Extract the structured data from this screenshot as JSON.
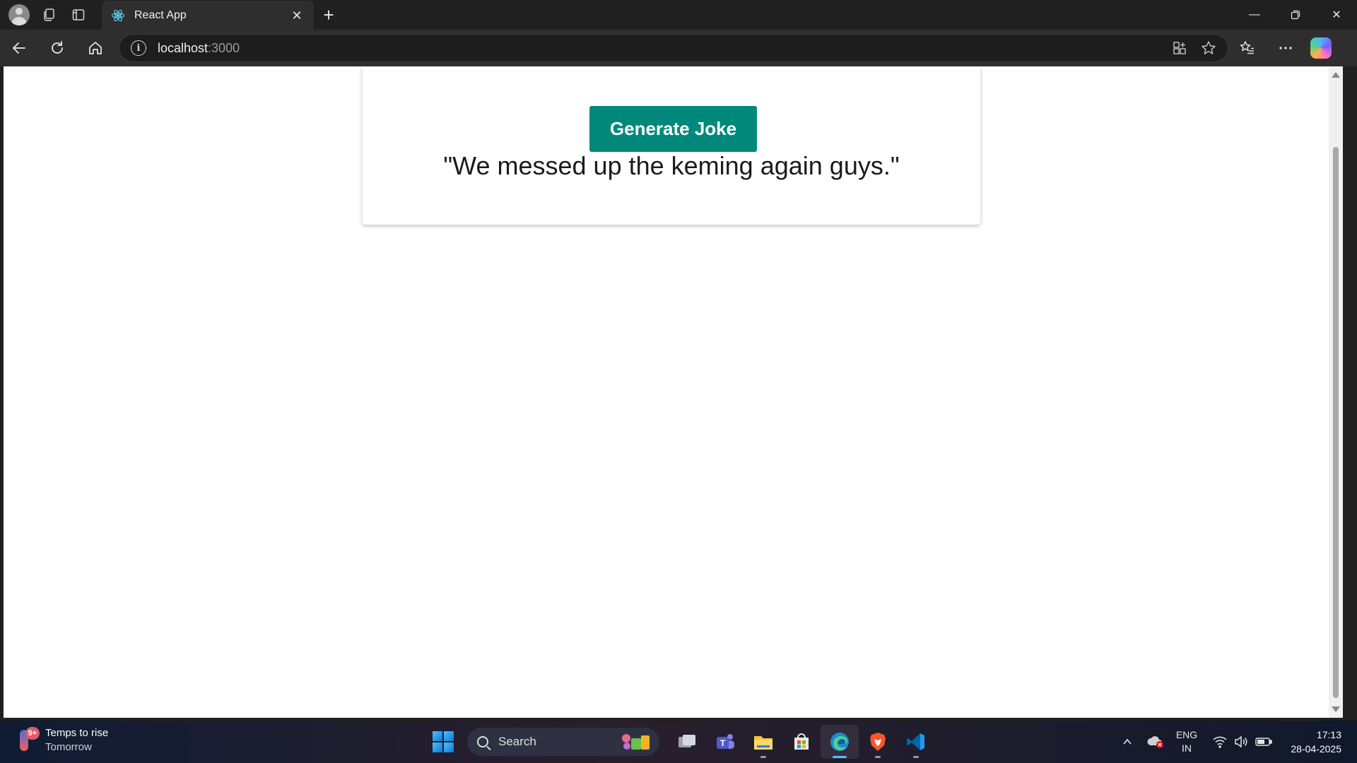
{
  "browser": {
    "tab_title": "React App",
    "address_host": "localhost",
    "address_port": ":3000"
  },
  "page": {
    "button_label": "Generate Joke",
    "joke_text": "\"We messed up the keming again guys.\"",
    "accent_color": "#00897b"
  },
  "taskbar": {
    "weather_badge": "9+",
    "weather_line1": "Temps to rise",
    "weather_line2": "Tomorrow",
    "search_placeholder": "Search",
    "language_line1": "ENG",
    "language_line2": "IN",
    "time": "17:13",
    "date": "28-04-2025"
  }
}
